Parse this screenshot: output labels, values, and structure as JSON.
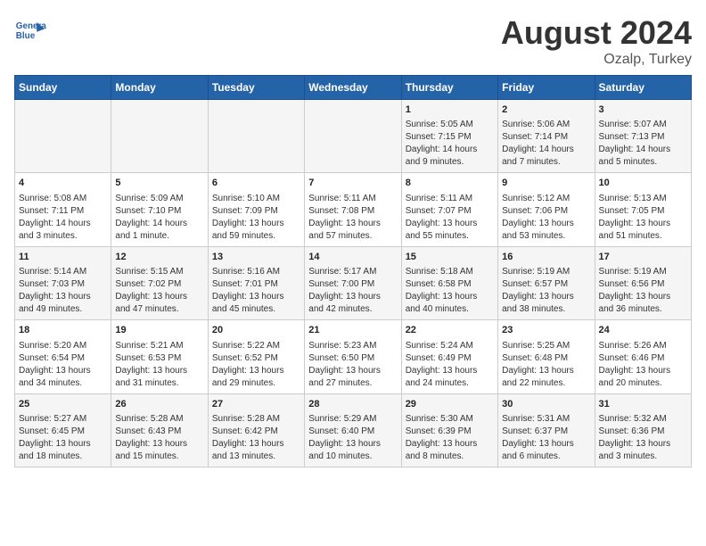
{
  "header": {
    "logo_line1": "General",
    "logo_line2": "Blue",
    "title": "August 2024",
    "subtitle": "Ozalp, Turkey"
  },
  "days_of_week": [
    "Sunday",
    "Monday",
    "Tuesday",
    "Wednesday",
    "Thursday",
    "Friday",
    "Saturday"
  ],
  "weeks": [
    [
      {
        "num": "",
        "info": ""
      },
      {
        "num": "",
        "info": ""
      },
      {
        "num": "",
        "info": ""
      },
      {
        "num": "",
        "info": ""
      },
      {
        "num": "1",
        "info": "Sunrise: 5:05 AM\nSunset: 7:15 PM\nDaylight: 14 hours\nand 9 minutes."
      },
      {
        "num": "2",
        "info": "Sunrise: 5:06 AM\nSunset: 7:14 PM\nDaylight: 14 hours\nand 7 minutes."
      },
      {
        "num": "3",
        "info": "Sunrise: 5:07 AM\nSunset: 7:13 PM\nDaylight: 14 hours\nand 5 minutes."
      }
    ],
    [
      {
        "num": "4",
        "info": "Sunrise: 5:08 AM\nSunset: 7:11 PM\nDaylight: 14 hours\nand 3 minutes."
      },
      {
        "num": "5",
        "info": "Sunrise: 5:09 AM\nSunset: 7:10 PM\nDaylight: 14 hours\nand 1 minute."
      },
      {
        "num": "6",
        "info": "Sunrise: 5:10 AM\nSunset: 7:09 PM\nDaylight: 13 hours\nand 59 minutes."
      },
      {
        "num": "7",
        "info": "Sunrise: 5:11 AM\nSunset: 7:08 PM\nDaylight: 13 hours\nand 57 minutes."
      },
      {
        "num": "8",
        "info": "Sunrise: 5:11 AM\nSunset: 7:07 PM\nDaylight: 13 hours\nand 55 minutes."
      },
      {
        "num": "9",
        "info": "Sunrise: 5:12 AM\nSunset: 7:06 PM\nDaylight: 13 hours\nand 53 minutes."
      },
      {
        "num": "10",
        "info": "Sunrise: 5:13 AM\nSunset: 7:05 PM\nDaylight: 13 hours\nand 51 minutes."
      }
    ],
    [
      {
        "num": "11",
        "info": "Sunrise: 5:14 AM\nSunset: 7:03 PM\nDaylight: 13 hours\nand 49 minutes."
      },
      {
        "num": "12",
        "info": "Sunrise: 5:15 AM\nSunset: 7:02 PM\nDaylight: 13 hours\nand 47 minutes."
      },
      {
        "num": "13",
        "info": "Sunrise: 5:16 AM\nSunset: 7:01 PM\nDaylight: 13 hours\nand 45 minutes."
      },
      {
        "num": "14",
        "info": "Sunrise: 5:17 AM\nSunset: 7:00 PM\nDaylight: 13 hours\nand 42 minutes."
      },
      {
        "num": "15",
        "info": "Sunrise: 5:18 AM\nSunset: 6:58 PM\nDaylight: 13 hours\nand 40 minutes."
      },
      {
        "num": "16",
        "info": "Sunrise: 5:19 AM\nSunset: 6:57 PM\nDaylight: 13 hours\nand 38 minutes."
      },
      {
        "num": "17",
        "info": "Sunrise: 5:19 AM\nSunset: 6:56 PM\nDaylight: 13 hours\nand 36 minutes."
      }
    ],
    [
      {
        "num": "18",
        "info": "Sunrise: 5:20 AM\nSunset: 6:54 PM\nDaylight: 13 hours\nand 34 minutes."
      },
      {
        "num": "19",
        "info": "Sunrise: 5:21 AM\nSunset: 6:53 PM\nDaylight: 13 hours\nand 31 minutes."
      },
      {
        "num": "20",
        "info": "Sunrise: 5:22 AM\nSunset: 6:52 PM\nDaylight: 13 hours\nand 29 minutes."
      },
      {
        "num": "21",
        "info": "Sunrise: 5:23 AM\nSunset: 6:50 PM\nDaylight: 13 hours\nand 27 minutes."
      },
      {
        "num": "22",
        "info": "Sunrise: 5:24 AM\nSunset: 6:49 PM\nDaylight: 13 hours\nand 24 minutes."
      },
      {
        "num": "23",
        "info": "Sunrise: 5:25 AM\nSunset: 6:48 PM\nDaylight: 13 hours\nand 22 minutes."
      },
      {
        "num": "24",
        "info": "Sunrise: 5:26 AM\nSunset: 6:46 PM\nDaylight: 13 hours\nand 20 minutes."
      }
    ],
    [
      {
        "num": "25",
        "info": "Sunrise: 5:27 AM\nSunset: 6:45 PM\nDaylight: 13 hours\nand 18 minutes."
      },
      {
        "num": "26",
        "info": "Sunrise: 5:28 AM\nSunset: 6:43 PM\nDaylight: 13 hours\nand 15 minutes."
      },
      {
        "num": "27",
        "info": "Sunrise: 5:28 AM\nSunset: 6:42 PM\nDaylight: 13 hours\nand 13 minutes."
      },
      {
        "num": "28",
        "info": "Sunrise: 5:29 AM\nSunset: 6:40 PM\nDaylight: 13 hours\nand 10 minutes."
      },
      {
        "num": "29",
        "info": "Sunrise: 5:30 AM\nSunset: 6:39 PM\nDaylight: 13 hours\nand 8 minutes."
      },
      {
        "num": "30",
        "info": "Sunrise: 5:31 AM\nSunset: 6:37 PM\nDaylight: 13 hours\nand 6 minutes."
      },
      {
        "num": "31",
        "info": "Sunrise: 5:32 AM\nSunset: 6:36 PM\nDaylight: 13 hours\nand 3 minutes."
      }
    ]
  ]
}
